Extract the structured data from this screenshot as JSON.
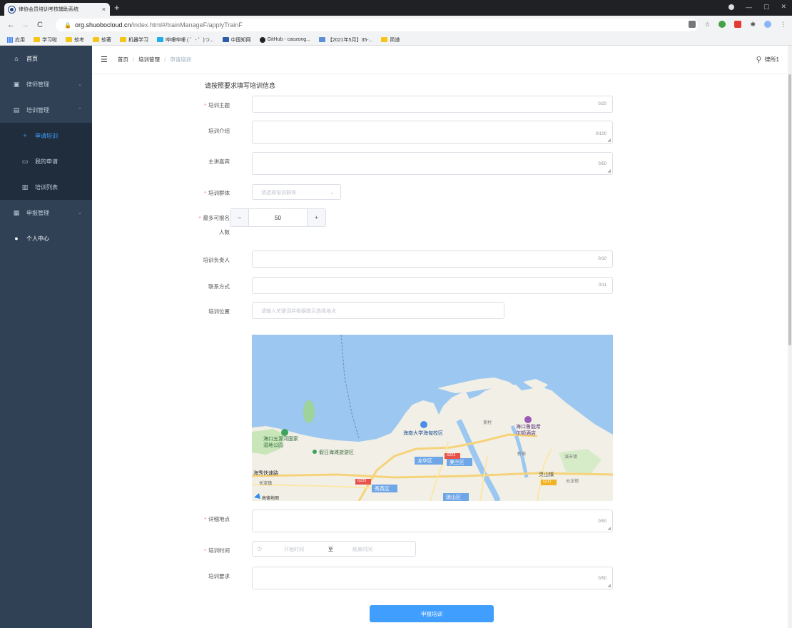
{
  "browser": {
    "tab_title": "律协会员培训考核辅助系统",
    "tab_close": "×",
    "new_tab": "+",
    "url_host": "org.shuobocloud.cn",
    "url_path": "/index.html#/trainManageF/applyTrainF",
    "bookmarks": [
      {
        "label": "应用",
        "icon": "apps-grid-icon"
      },
      {
        "label": "学习啦",
        "icon": "folder-icon"
      },
      {
        "label": "软考",
        "icon": "folder-icon"
      },
      {
        "label": "软著",
        "icon": "folder-icon"
      },
      {
        "label": "机器学习",
        "icon": "folder-icon"
      },
      {
        "label": "哔哩哔哩 ( ゜- ゜)つ...",
        "icon": "bilibili-icon"
      },
      {
        "label": "中国知网",
        "icon": "cnki-icon"
      },
      {
        "label": "GitHub - caozong...",
        "icon": "github-icon"
      },
      {
        "label": "【2021年5月】35-...",
        "icon": "bookmark-icon"
      },
      {
        "label": "简谱",
        "icon": "folder-icon"
      }
    ]
  },
  "sidebar": {
    "items": [
      {
        "label": "首页",
        "icon": "home-icon"
      },
      {
        "label": "律师管理",
        "icon": "lawyer-icon",
        "arrow": "⌄"
      },
      {
        "label": "培训管理",
        "icon": "training-icon",
        "arrow": "⌃"
      },
      {
        "label": "申请培训",
        "icon": "plus-icon"
      },
      {
        "label": "我的申请",
        "icon": "document-icon"
      },
      {
        "label": "培训列表",
        "icon": "list-icon"
      },
      {
        "label": "申报管理",
        "icon": "report-icon",
        "arrow": "⌄"
      },
      {
        "label": "个人中心",
        "icon": "user-icon"
      }
    ]
  },
  "navbar": {
    "breadcrumb": [
      "首页",
      "培训管理",
      "申请培训"
    ],
    "separator": "/",
    "user": "律所1"
  },
  "form": {
    "title": "请按照要求填写培训信息",
    "topic_label": "培训主题",
    "topic_count": "0/20",
    "intro_label": "培训介绍",
    "intro_count": "0/100",
    "guest_label": "主讲嘉宾",
    "guest_count": "0/50",
    "group_label": "培训群体",
    "group_placeholder": "请选择培训群体",
    "max_label_line1": "最多可报名",
    "max_label_line2": "人数",
    "max_value": "50",
    "minus": "−",
    "plus": "+",
    "leader_label": "培训负责人",
    "leader_count": "0/10",
    "contact_label": "联系方式",
    "contact_count": "0/11",
    "location_label": "培训位置",
    "location_placeholder": "请输入关键词并根据提示选择地点",
    "address_label": "详细地点",
    "address_count": "0/50",
    "time_label": "培训时间",
    "time_start": "开始时间",
    "time_to": "至",
    "time_end": "结束时间",
    "req_label": "培训要求",
    "req_count": "0/50",
    "submit": "申报培训"
  },
  "map": {
    "labels": [
      "海口五源河国家湿地公园",
      "海南大学海甸校区",
      "海口鲁能希尔顿酒店",
      "假日海滩旅游区",
      "龙华区",
      "美兰区",
      "秀英区",
      "琼山区",
      "海秀快速路",
      "长流镇",
      "灵山镇",
      "新埠",
      "演丰镇",
      "云龙镇",
      "美村",
      "高德地图"
    ],
    "road_labels": [
      "G223",
      "G225",
      "G111"
    ]
  },
  "colors": {
    "sidebar_bg": "#304156",
    "submenu_bg": "#1f2d3d",
    "active": "#409eff",
    "required": "#f56c6c",
    "primary_button": "#409eff"
  }
}
